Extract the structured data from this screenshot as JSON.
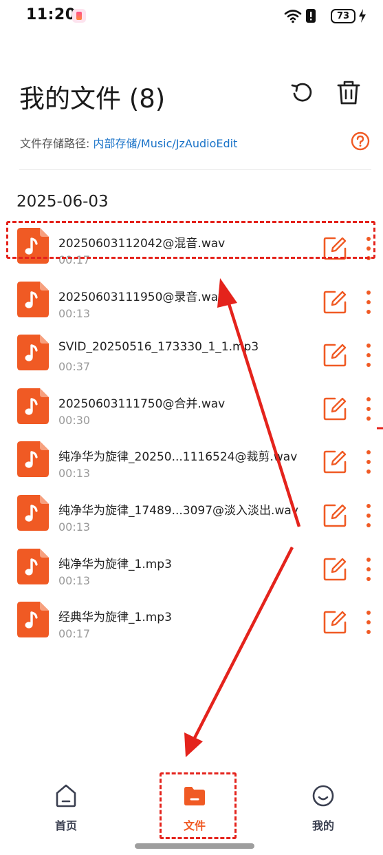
{
  "status_bar": {
    "time": "11:20",
    "battery_level": "73",
    "icons": [
      "app-notification-icon",
      "wifi-icon",
      "alert-icon",
      "battery-icon",
      "charging-icon"
    ]
  },
  "header": {
    "title": "我的文件 (8)",
    "refresh_icon": "refresh-icon",
    "delete_icon": "trash-icon"
  },
  "storage_path": {
    "label": "文件存储路径:",
    "link": "内部存储/Music/JzAudioEdit",
    "help_icon": "help-icon"
  },
  "date_group": "2025-06-03",
  "files": [
    {
      "name": "20250603112042@混音.wav",
      "duration": "00:17"
    },
    {
      "name": "20250603111950@录音.wav",
      "duration": "00:13"
    },
    {
      "name": "SVID_20250516_173330_1_1.mp3",
      "duration": "00:37"
    },
    {
      "name": "20250603111750@合并.wav",
      "duration": "00:30"
    },
    {
      "name": "纯净华为旋律_20250...1116524@裁剪.wav",
      "duration": "00:13"
    },
    {
      "name": "纯净华为旋律_17489...3097@淡入淡出.wav",
      "duration": "00:13"
    },
    {
      "name": "纯净华为旋律_1.mp3",
      "duration": "00:13"
    },
    {
      "name": "经典华为旋律_1.mp3",
      "duration": "00:17"
    }
  ],
  "bottom_nav": [
    {
      "label": "首页",
      "icon": "home-icon",
      "active": false
    },
    {
      "label": "文件",
      "icon": "folder-icon",
      "active": true
    },
    {
      "label": "我的",
      "icon": "smiley-icon",
      "active": false
    }
  ],
  "colors": {
    "accent": "#f05a24",
    "link": "#1a73c8",
    "annotation": "#e4231c",
    "nav_inactive": "#3a3f50"
  }
}
